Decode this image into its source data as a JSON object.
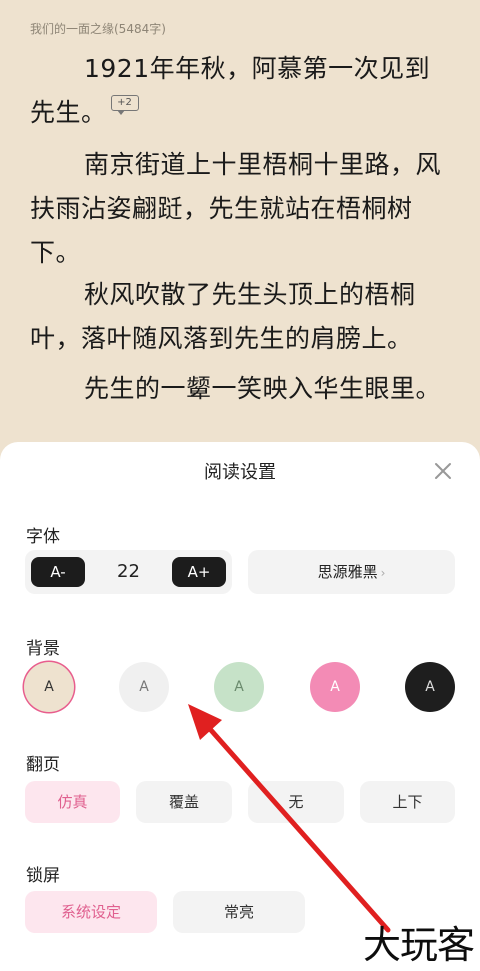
{
  "reader": {
    "chapter_header": "我们的一面之缘(5484字)",
    "paragraphs": [
      "1921年年秋，阿慕第一次见到先生。",
      "南京街道上十里梧桐十里路，风扶雨沾姿翩跹，先生就站在梧桐树下。",
      "秋风吹散了先生头顶上的梧桐叶，落叶随风落到先生的肩膀上。",
      "先生的一颦一笑映入华生眼里。"
    ],
    "comment_badge": "+2"
  },
  "settings": {
    "title": "阅读设置",
    "font": {
      "label": "字体",
      "decrease": "A-",
      "size": "22",
      "increase": "A+",
      "family": "思源雅黑"
    },
    "background": {
      "label": "背景",
      "swatches": [
        {
          "letter": "A",
          "color": "#eee2cf",
          "selected": true
        },
        {
          "letter": "A",
          "color": "#f0f0f0",
          "selected": false
        },
        {
          "letter": "A",
          "color": "#c6e2c8",
          "selected": false
        },
        {
          "letter": "A",
          "color": "#f38bb5",
          "selected": false
        },
        {
          "letter": "A",
          "color": "#1e1e1e",
          "selected": false
        }
      ]
    },
    "page_turn": {
      "label": "翻页",
      "options": [
        "仿真",
        "覆盖",
        "无",
        "上下"
      ],
      "selected": "仿真"
    },
    "lock_screen": {
      "label": "锁屏",
      "options": [
        "系统设定",
        "常亮"
      ],
      "selected": "系统设定"
    }
  },
  "watermark": "大玩客",
  "colors": {
    "accent": "#e0608f",
    "arrow": "#e02020"
  }
}
